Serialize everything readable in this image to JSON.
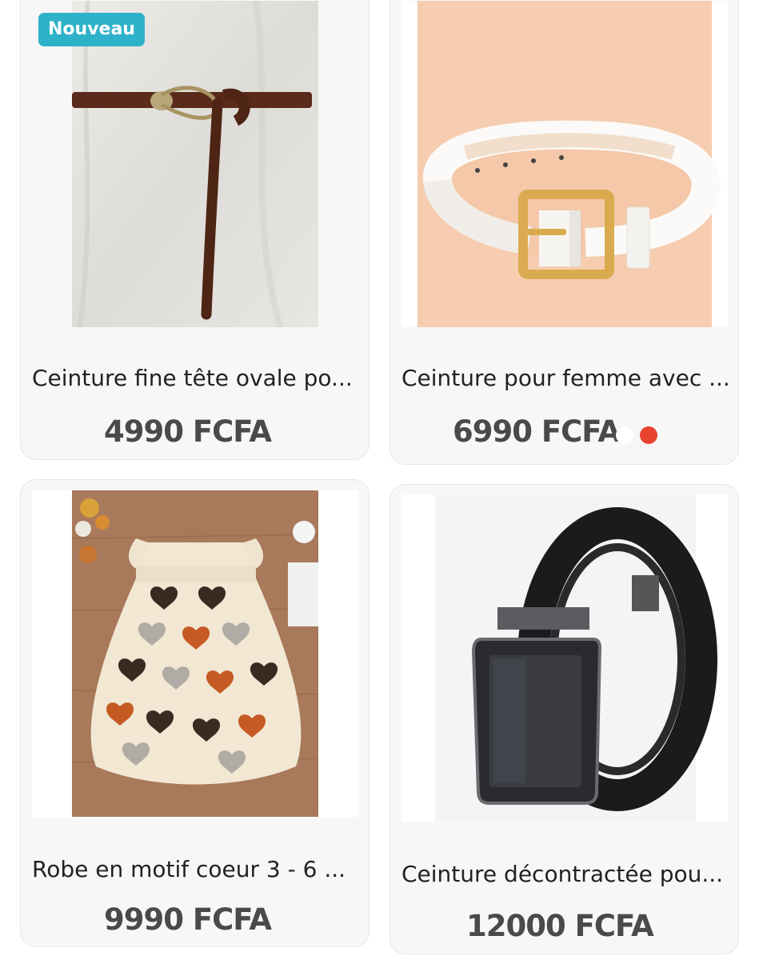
{
  "colors": {
    "badge": "#2eb2c9",
    "price_text": "#4a4a4a",
    "card_bg": "#f7f7f7",
    "dot_active": "#e8412f",
    "dot_inactive": "#ffffff"
  },
  "products": [
    {
      "badge": "Nouveau",
      "title": "Ceinture fine tête ovale po...",
      "price": "4990 FCFA",
      "image_icon": "brown-thin-belt-photo"
    },
    {
      "title": "Ceinture pour femme avec ...",
      "price": "6990 FCFA",
      "image_icon": "white-belt-gold-buckle-photo"
    },
    {
      "title": "Robe en motif coeur 3 - 6 ...",
      "price": "9990 FCFA",
      "image_icon": "heart-print-dress-photo"
    },
    {
      "title": "Ceinture décontractée pou...",
      "price": "12000 FCFA",
      "image_icon": "black-leather-belt-photo"
    }
  ],
  "carousel": {
    "dot_count": 2,
    "active_index": 1
  }
}
